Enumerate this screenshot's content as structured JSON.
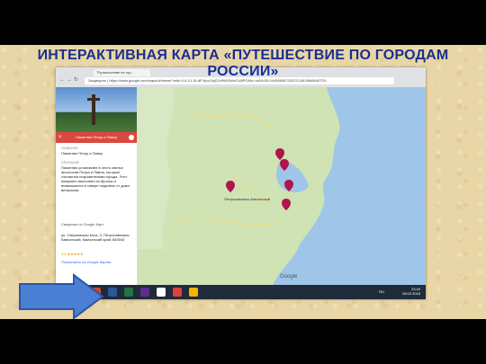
{
  "slide": {
    "title": "ИНТЕРАКТИВНАЯ КАРТА «ПУТЕШЕСТВИЕ ПО ГОРОДАМ РОССИИ»"
  },
  "browser": {
    "tab_title": "\"Путешествие по гор...",
    "address": "Защищено | https://www.google.com/maps/d/viewer?mid=1f-LX1-SLAP-6pcGkjG1z9WlOr9zGU8PO&hl=ru&ll=53.04459656725223,158.5968640729..."
  },
  "panel": {
    "place_title": "Памятник Петру и Павлу",
    "name_label": "НАЗВАНИЕ",
    "name_value": "Памятник Петру и Павлу",
    "desc_label": "ОПИСАНИЕ",
    "desc_value": "Памятник установлен в честь святых апостолов Петра и Павла, которые считаются покровителями города. Этот монумент выполнен из бронзы и возвышается в сквере недалеко от дома ветеранов.",
    "info_header": "Сведения из Google Карт",
    "address": "ул. Озерновская Коса, 3, Петропавловск-Камчатский, Камчатский край, 683040",
    "rating": "4,6 ★★★★★",
    "maps_link": "Посмотреть на Google Картах"
  },
  "map": {
    "city_label": "Петропавловск-Камчатский",
    "logo": "Google"
  },
  "taskbar": {
    "time": "23:40",
    "date": "28.02.2018",
    "lang": "RU"
  },
  "colors": {
    "title": "#1a2f8f",
    "arrow_fill": "#4a7fd4",
    "arrow_stroke": "#2a55a8",
    "marker": "#b0154e"
  },
  "icons": [
    "back-icon",
    "forward-icon",
    "reload-icon",
    "close-icon",
    "directions-icon",
    "map-marker-icon",
    "windows-start-icon",
    "right-arrow-icon"
  ]
}
